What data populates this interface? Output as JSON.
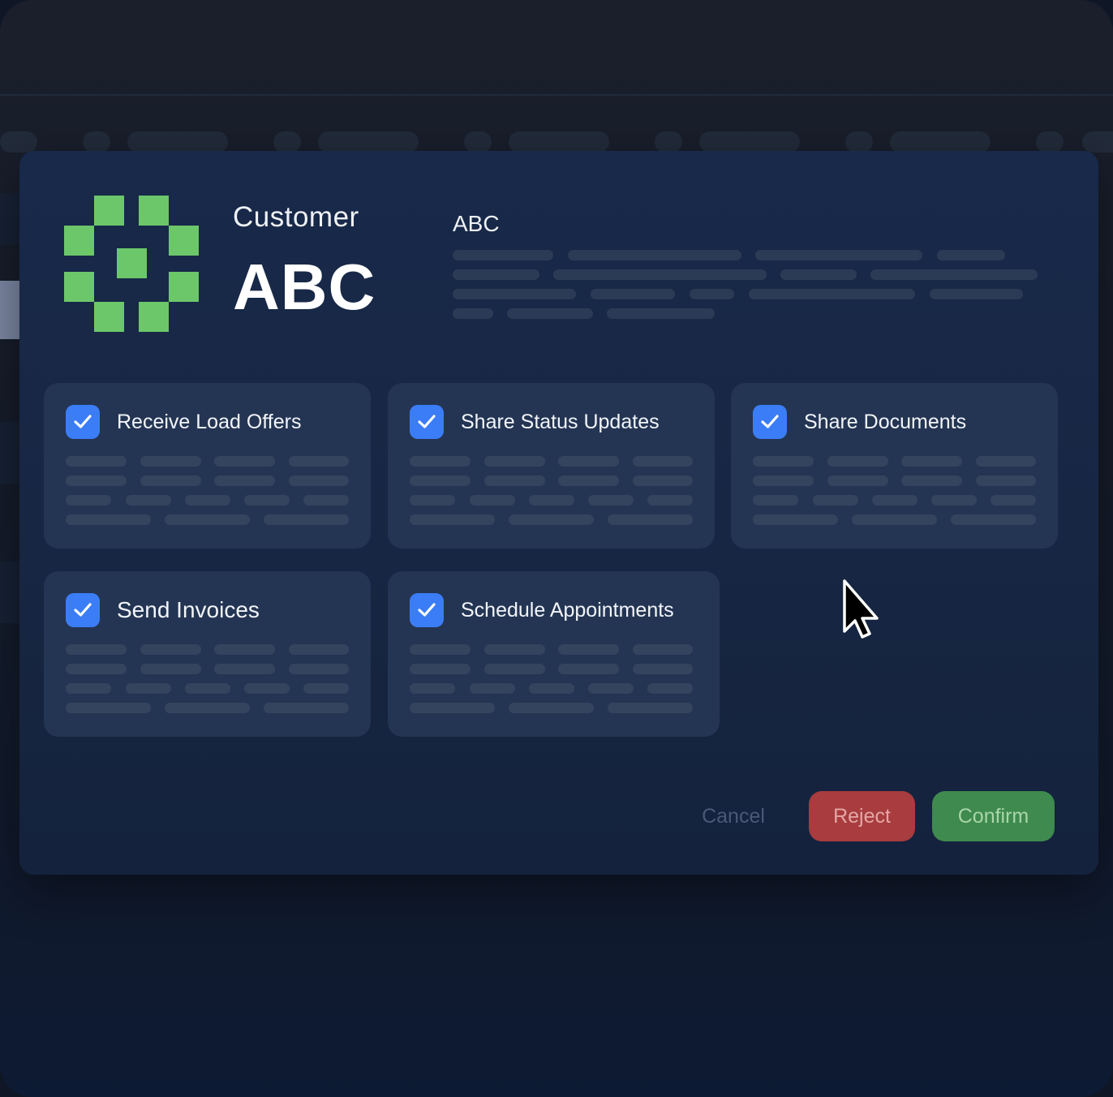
{
  "customer": {
    "label": "Customer",
    "name": "ABC",
    "name_small": "ABC"
  },
  "permissions": [
    {
      "label": "Receive Load Offers",
      "checked": true
    },
    {
      "label": "Share Status Updates",
      "checked": true
    },
    {
      "label": "Share Documents",
      "checked": true
    },
    {
      "label": "Send Invoices",
      "checked": true
    },
    {
      "label": "Schedule Appointments",
      "checked": true
    }
  ],
  "actions": {
    "cancel": "Cancel",
    "reject": "Reject",
    "confirm": "Confirm"
  },
  "colors": {
    "logo": "#6cc76a",
    "checkbox": "#3b7df6",
    "reject": "#a83c3e",
    "confirm": "#3f8a4e"
  },
  "icons": {
    "logo": "pixel-logo-icon",
    "checkbox": "checkmark-icon",
    "cursor": "mouse-pointer-icon"
  }
}
